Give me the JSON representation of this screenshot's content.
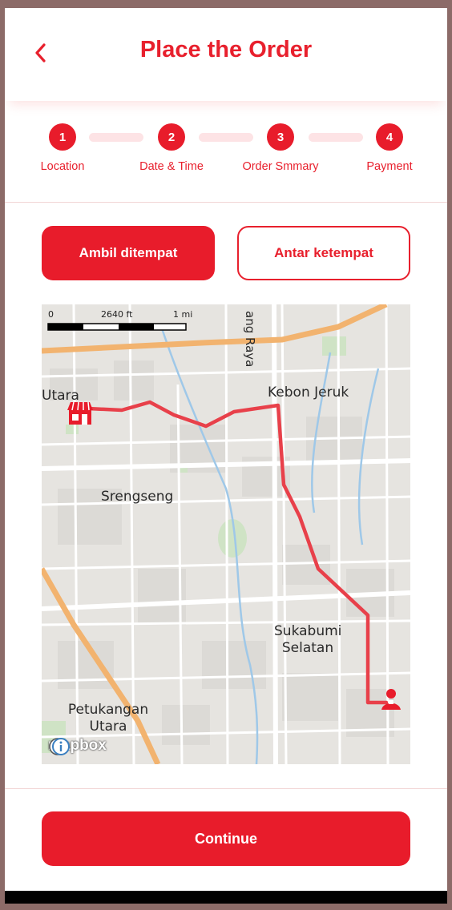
{
  "header": {
    "title": "Place the Order",
    "back_icon": "chevron-left-icon"
  },
  "steps": [
    {
      "number": "1",
      "label": "Location"
    },
    {
      "number": "2",
      "label": "Date & Time"
    },
    {
      "number": "3",
      "label": "Order Smmary"
    },
    {
      "number": "4",
      "label": "Payment"
    }
  ],
  "delivery_tabs": {
    "pickup_label": "Ambil ditempat",
    "delivery_label": "Antar ketempat",
    "selected": "pickup"
  },
  "map": {
    "labels": {
      "utara": "Utara",
      "kebon_jeruk": "Kebon Jeruk",
      "srengseng": "Srengseng",
      "sukabumi": "Sukabumi",
      "selatan": "Selatan",
      "petukangan": "Petukangan",
      "petukangan_utara": "Utara",
      "road": "ang Raya"
    },
    "scale": {
      "zero": "0",
      "mid": "2640 ft",
      "end": "1 mi"
    },
    "attribution": "mapbox",
    "store_icon": "store-icon",
    "user_icon": "user-pin-icon",
    "info_icon": "info-icon",
    "route_color": "#e8404a"
  },
  "footer": {
    "continue_label": "Continue"
  },
  "colors": {
    "primary": "#e81c2b",
    "step_track": "#fde3e5"
  }
}
